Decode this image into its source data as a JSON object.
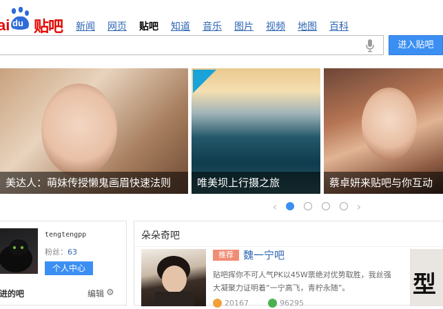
{
  "logo": {
    "text_bai": "ai",
    "text_du": "du",
    "text_tieba": "贴吧"
  },
  "nav": {
    "items": [
      {
        "label": "新闻"
      },
      {
        "label": "网页"
      },
      {
        "label": "贴吧"
      },
      {
        "label": "知道"
      },
      {
        "label": "音乐"
      },
      {
        "label": "图片"
      },
      {
        "label": "视频"
      },
      {
        "label": "地图"
      },
      {
        "label": "百科"
      }
    ],
    "active": "贴吧"
  },
  "search": {
    "value": "",
    "placeholder": "",
    "enter_button": "进入贴吧",
    "mic_icon": "microphone-icon"
  },
  "carousel": {
    "slides": [
      {
        "caption": "美达人：萌妹传授懒鬼画眉快速法则"
      },
      {
        "caption": "唯美坝上行摄之旅"
      },
      {
        "caption": "蔡卓妍来贴吧与你互动"
      }
    ],
    "active_index": 0,
    "prev_icon": "chevron-left-icon",
    "next_icon": "chevron-right-icon"
  },
  "user": {
    "name": "tengtengpp",
    "fans_label": "粉丝：",
    "fans_count": "63",
    "center_button": "个人中心",
    "my_bars_label": "进的吧",
    "edit_label": "编辑",
    "settings_icon": "gear-icon"
  },
  "feed": {
    "title": "朵朵奇吧",
    "badge": "推荐",
    "bar_name": "魏一宁吧",
    "text": "贴吧挥你不可人气PK以45W票绝对优势取胜，我丝强大凝聚力证明着“一宁高飞，青柠永随”。",
    "stat1": "20167",
    "stat2": "96295",
    "side_text": "型"
  },
  "colors": {
    "brand_red": "#e10601",
    "link_blue": "#2d64b3",
    "button_blue": "#3c8ff2",
    "badge_orange": "#f18c74"
  }
}
